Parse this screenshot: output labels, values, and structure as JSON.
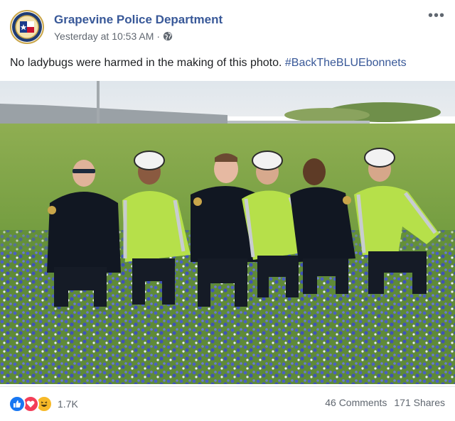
{
  "post": {
    "page_name": "Grapevine Police Department",
    "timestamp": "Yesterday at 10:53 AM",
    "separator": "·",
    "more_label": "•••",
    "caption_text": "No ladybugs were harmed in the making of this photo. ",
    "caption_hashtag": "#BackTheBLUEbonnets",
    "icons": {
      "avatar": "police-badge-logo",
      "privacy": "globe-icon",
      "more": "more-options-icon",
      "like": "like-reaction-icon",
      "love": "love-reaction-icon",
      "haha": "haha-reaction-icon"
    },
    "reactions_count": "1.7K",
    "comments_label": "46 Comments",
    "shares_label": "171 Shares",
    "colors": {
      "link_blue": "#385898",
      "secondary_text": "#606770",
      "like_blue": "#1877f2",
      "love_red": "#f33e58",
      "haha_yellow": "#f7b928"
    }
  }
}
